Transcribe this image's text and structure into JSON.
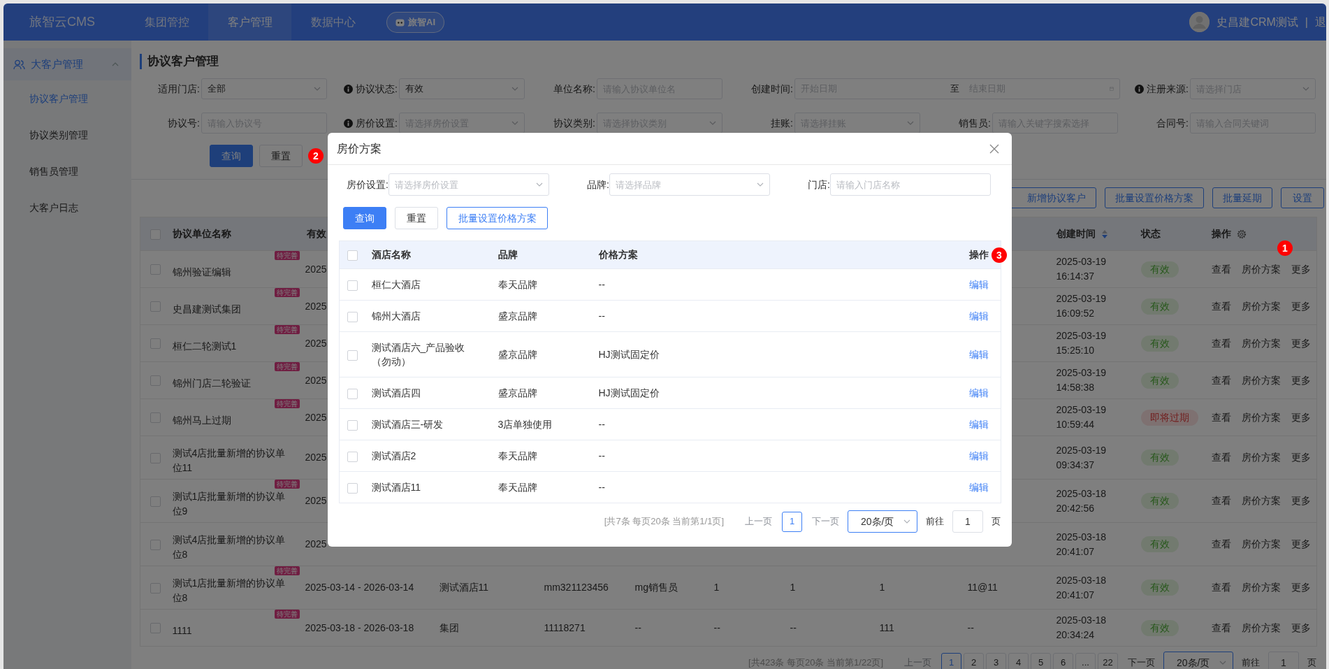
{
  "nav": {
    "logo": "旅智云CMS",
    "menu": [
      {
        "label": "集团管控",
        "selected": false
      },
      {
        "label": "客户管理",
        "selected": true
      },
      {
        "label": "数据中心",
        "selected": false
      }
    ],
    "ai_button": "旅智AI",
    "user": "史昌建CRM测试",
    "separator": "|",
    "logout": "退"
  },
  "sidebar": {
    "group": {
      "label": "大客户管理",
      "expanded": true
    },
    "items": [
      {
        "label": "协议客户管理",
        "selected": true
      },
      {
        "label": "协议类别管理",
        "selected": false
      },
      {
        "label": "销售员管理",
        "selected": false
      },
      {
        "label": "大客户日志",
        "selected": false
      }
    ]
  },
  "page_title": "协议客户管理",
  "filters": [
    {
      "label": "适用门店:",
      "kind": "select",
      "value": "全部"
    },
    {
      "label": "协议状态:",
      "kind": "select",
      "info": true,
      "value": "有效"
    },
    {
      "label": "单位名称:",
      "kind": "text",
      "placeholder": "请输入协议单位名"
    },
    {
      "label": "创建时间:",
      "kind": "daterange",
      "start_placeholder": "开始日期",
      "separator": "至",
      "end_placeholder": "结束日期"
    },
    {
      "label": "注册来源:",
      "kind": "select",
      "info": true,
      "placeholder": "请选择门店"
    },
    {
      "label": "协议号:",
      "kind": "text",
      "placeholder": "请输入协议号"
    },
    {
      "label": "房价设置:",
      "kind": "select",
      "info": true,
      "placeholder": "请选择房价设置"
    },
    {
      "label": "协议类别:",
      "kind": "select",
      "placeholder": "请选择协议类别"
    },
    {
      "label": "挂账:",
      "kind": "select",
      "placeholder": "请选择挂账"
    },
    {
      "label": "销售员:",
      "kind": "text",
      "placeholder": "请输入关键字搜索选择"
    },
    {
      "label": "合同号:",
      "kind": "text",
      "placeholder": "请输入合同关键词"
    }
  ],
  "filter_buttons": [
    {
      "label": "查询",
      "kind": "primary"
    },
    {
      "label": "重置",
      "kind": "default"
    }
  ],
  "toolbar": [
    "新增协议客户",
    "批量设置价格方案",
    "批量延期",
    "设置"
  ],
  "table": {
    "all_checked": false,
    "columns": [
      {
        "label": "协议单位名称"
      },
      {
        "label": "有效"
      },
      {
        "label": "创建时间",
        "sorted_descending": true
      },
      {
        "label": "状态"
      },
      {
        "label": "操作"
      }
    ],
    "rows": [
      {
        "checked": false,
        "name": "锦州验证编辑",
        "tag": "待完善",
        "validity": "2025",
        "created": "2025-03-19 16:14:37",
        "status": {
          "text": "有效",
          "kind": "valid"
        },
        "actions": [
          "查看",
          "房价方案",
          "更多"
        ]
      },
      {
        "checked": false,
        "name": "史昌建测试集团",
        "tag": "待完善",
        "validity": "2025",
        "created": "2025-03-19 16:09:52",
        "status": {
          "text": "有效",
          "kind": "valid"
        },
        "actions": [
          "查看",
          "房价方案",
          "更多"
        ]
      },
      {
        "checked": false,
        "name": "桓仁二轮测试1",
        "tag": "待完善",
        "validity": "2025",
        "created": "2025-03-19 15:25:10",
        "status": {
          "text": "有效",
          "kind": "valid"
        },
        "actions": [
          "查看",
          "房价方案",
          "更多"
        ]
      },
      {
        "checked": false,
        "name": "锦州门店二轮验证",
        "tag": "待完善",
        "validity": "2025",
        "created": "2025-03-19 14:58:38",
        "status": {
          "text": "有效",
          "kind": "valid"
        },
        "actions": [
          "查看",
          "房价方案",
          "更多"
        ]
      },
      {
        "checked": false,
        "name": "锦州马上过期",
        "tag": "待完善",
        "validity": "2025",
        "created": "2025-03-19 10:59:44",
        "status": {
          "text": "即将过期",
          "kind": "expiring"
        },
        "actions": [
          "查看",
          "房价方案",
          "更多"
        ]
      },
      {
        "checked": false,
        "name": "测试4店批量新增的协议单位11",
        "validity": "2025",
        "created": "2025-03-19 09:34:37",
        "status": {
          "text": "有效",
          "kind": "valid"
        },
        "actions": [
          "查看",
          "房价方案",
          "更多"
        ]
      },
      {
        "checked": false,
        "name": "测试1店批量新增的协议单位9",
        "tag": "待完善",
        "validity": "2025",
        "created": "2025-03-18 20:42:56",
        "status": {
          "text": "有效",
          "kind": "valid"
        },
        "actions": [
          "查看",
          "房价方案",
          "更多"
        ]
      },
      {
        "checked": false,
        "name": "测试4店批量新增的协议单位8",
        "validity": "2025",
        "created": "2025-03-18 20:41:07",
        "status": {
          "text": "有效",
          "kind": "valid"
        },
        "actions": [
          "查看",
          "房价方案",
          "更多"
        ]
      },
      {
        "checked": false,
        "name": "测试1店批量新增的协议单位8",
        "tag": "待完善",
        "validity": "2025-03-14 - 2026-03-14",
        "cells": [
          "测试酒店11",
          "mm321123456",
          "mg销售员",
          "1",
          "1",
          "1",
          "11@11"
        ],
        "created": "2025-03-18 20:41:07",
        "status": {
          "text": "有效",
          "kind": "valid"
        },
        "actions": [
          "查看",
          "房价方案",
          "更多"
        ]
      },
      {
        "checked": false,
        "name": "1111",
        "tag": "待完善",
        "validity": "2025-03-18 - 2026-03-18",
        "cells": [
          "集团",
          "11118271",
          "--",
          "--",
          "--",
          "111",
          "--"
        ],
        "created": "2025-03-18 20:34:24",
        "status": {
          "text": "有效",
          "kind": "valid"
        },
        "actions": [
          "查看",
          "房价方案",
          "更多"
        ]
      }
    ]
  },
  "pagination": {
    "summary": "[共423条 每页20条 当前第1/22页]",
    "prev": {
      "label": "上一页",
      "disabled": true
    },
    "pages": [
      {
        "label": "1",
        "selected": true
      },
      {
        "label": "2",
        "selected": false
      },
      {
        "label": "3",
        "selected": false
      },
      {
        "label": "4",
        "selected": false
      },
      {
        "label": "5",
        "selected": false
      },
      {
        "label": "6",
        "selected": false
      },
      {
        "label": "...",
        "selected": false
      },
      {
        "label": "22",
        "selected": false
      }
    ],
    "next": {
      "label": "下一页",
      "disabled": false
    },
    "page_size": "20条/页",
    "goto_label": "前往",
    "goto_value": "1",
    "page_suffix": "页"
  },
  "modal": {
    "title": "房价方案",
    "filters": [
      {
        "label": "房价设置:",
        "kind": "select",
        "placeholder": "请选择房价设置"
      },
      {
        "label": "品牌:",
        "kind": "select",
        "placeholder": "请选择品牌"
      },
      {
        "label": "门店:",
        "kind": "text",
        "placeholder": "请输入门店名称"
      }
    ],
    "buttons": [
      {
        "label": "查询",
        "kind": "primary"
      },
      {
        "label": "重置",
        "kind": "default"
      },
      {
        "label": "批量设置价格方案",
        "kind": "outline"
      }
    ],
    "table": {
      "all_checked": false,
      "columns": [
        "酒店名称",
        "品牌",
        "价格方案",
        "操作"
      ],
      "rows": [
        {
          "checked": false,
          "hotel": "桓仁大酒店",
          "brand": "奉天品牌",
          "plan": "--",
          "action": "编辑"
        },
        {
          "checked": false,
          "hotel": "锦州大酒店",
          "brand": "盛京品牌",
          "plan": "--",
          "action": "编辑"
        },
        {
          "checked": false,
          "hotel": "测试酒店六_产品验收（勿动）",
          "brand": "盛京品牌",
          "plan": "HJ测试固定价",
          "action": "编辑"
        },
        {
          "checked": false,
          "hotel": "测试酒店四",
          "brand": "盛京品牌",
          "plan": "HJ测试固定价",
          "action": "编辑"
        },
        {
          "checked": false,
          "hotel": "测试酒店三-研发",
          "brand": "3店单独使用",
          "plan": "--",
          "action": "编辑"
        },
        {
          "checked": false,
          "hotel": "测试酒店2",
          "brand": "奉天品牌",
          "plan": "--",
          "action": "编辑"
        },
        {
          "checked": false,
          "hotel": "测试酒店11",
          "brand": "奉天品牌",
          "plan": "--",
          "action": "编辑"
        }
      ]
    },
    "pagination": {
      "summary": "[共7条 每页20条 当前第1/1页]",
      "prev": {
        "label": "上一页",
        "disabled": true
      },
      "pages": [
        {
          "label": "1",
          "selected": true
        }
      ],
      "next": {
        "label": "下一页",
        "disabled": true
      },
      "page_size": "20条/页",
      "goto_label": "前往",
      "goto_value": "1",
      "page_suffix": "页"
    }
  },
  "annotations": [
    {
      "label": "1"
    },
    {
      "label": "2"
    },
    {
      "label": "3"
    }
  ]
}
